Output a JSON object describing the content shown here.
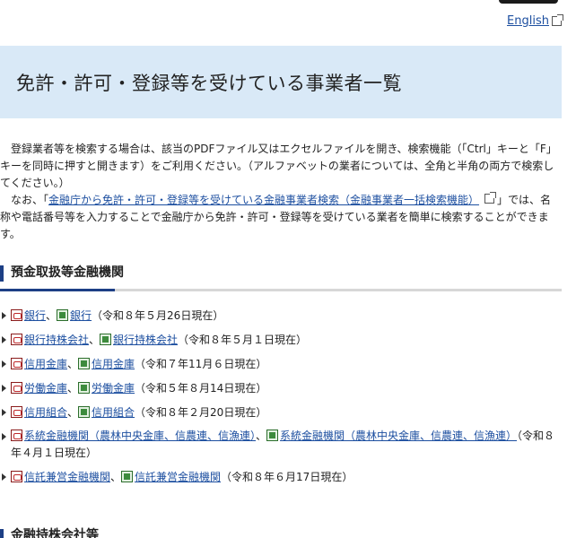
{
  "header": {
    "language_link": "English"
  },
  "page_title": "免許・許可・登録等を受けている事業者一覧",
  "intro": {
    "p1": "登録業者等を検索する場合は、該当のPDFファイル又はエクセルファイルを開き、検索機能（「Ctrl」キーと「F」キーを同時に押すと開きます）をご利用ください。（アルファベットの業者については、全角と半角の両方で検索してください。）",
    "p2_before": "なお、「",
    "p2_link": "金融庁から免許・許可・登録等を受けている金融事業者検索（金融事業者一括検索機能）",
    "p2_after": "」では、名称や電話番号等を入力することで金融庁から免許・許可・登録等を受けている業者を簡単に検索することができます。"
  },
  "section1": {
    "heading": "預金取扱等金融機関",
    "items": [
      {
        "pdf_label": "銀行",
        "xls_label": "銀行",
        "date": "（令和８年５月26日現在）"
      },
      {
        "pdf_label": "銀行持株会社",
        "xls_label": "銀行持株会社",
        "date": "（令和８年５月１日現在）"
      },
      {
        "pdf_label": "信用金庫",
        "xls_label": "信用金庫",
        "date": "（令和７年11月６日現在）"
      },
      {
        "pdf_label": "労働金庫",
        "xls_label": "労働金庫",
        "date": "（令和５年８月14日現在）"
      },
      {
        "pdf_label": "信用組合",
        "xls_label": "信用組合",
        "date": "（令和８年２月20日現在）"
      },
      {
        "pdf_label": "系統金融機関（農林中央金庫、信農連、信漁連）",
        "xls_label": "系統金融機関（農林中央金庫、信農連、信漁連）",
        "date": "（令和８年４月１日現在）"
      },
      {
        "pdf_label": "信託兼営金融機関",
        "xls_label": "信託兼営金融機関",
        "date": "（令和８年６月17日現在）"
      }
    ],
    "separator": "、"
  },
  "section2": {
    "heading": "金融持株会社等"
  },
  "icons": {
    "pdf": "pdf-file-icon",
    "xls": "excel-file-icon",
    "external": "external-link-icon",
    "bullet": "triangle-bullet-icon"
  },
  "colors": {
    "title_band": "#d9e9f7",
    "link": "#1d4fa0",
    "section_accent": "#1d3f85"
  }
}
